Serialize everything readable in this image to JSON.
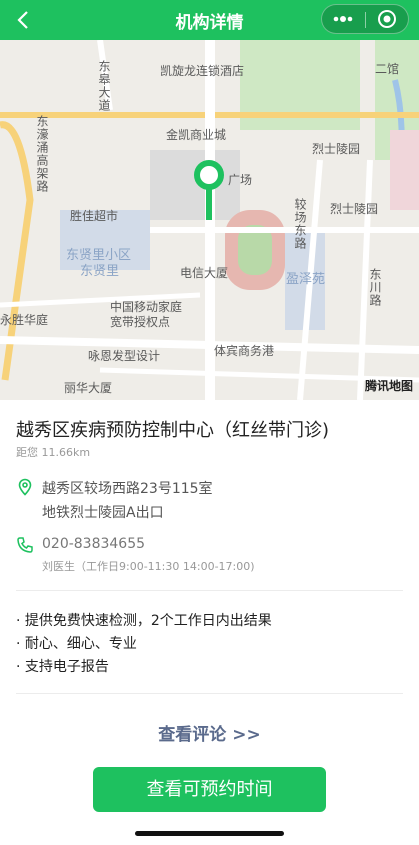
{
  "header": {
    "title": "机构详情"
  },
  "map": {
    "labels": {
      "kailong": "凯旋龙连锁酒店",
      "erguan": "二馆",
      "dongqiao": "东皋大道",
      "jinkai": "金凯商业城",
      "lieshi1": "烈士陵园",
      "donghao": "东濠涌高架路",
      "guangchang": "广场",
      "shengjia": "胜佳超市",
      "lieshi2": "烈士陵园",
      "jiaochang": "较场东路",
      "dongxian_xq": "东贤里小区",
      "dongxian": "东贤里",
      "dianxin": "电信大厦",
      "yingze": "盈泽苑",
      "dongchuan": "东川路",
      "yongsheng": "永胜华庭",
      "mobile1": "中国移动家庭",
      "mobile2": "宽带授权点",
      "tibin": "体宾商务港",
      "yongen": "咏恩发型设计",
      "lihua": "丽华大厦"
    },
    "brand": "腾讯地图"
  },
  "org": {
    "name": "越秀区疾病预防控制中心（红丝带门诊)",
    "distance": "距您 11.66km",
    "address_line1": "越秀区较场西路23号115室",
    "address_line2": "地铁烈士陵园A出口",
    "phone": "020-83834655",
    "contact": "刘医生（工作日9:00-11:30 14:00-17:00)"
  },
  "features": [
    "· 提供免费快速检测，2个工作日内出结果",
    "· 耐心、细心、专业",
    "· 支持电子报告"
  ],
  "actions": {
    "review": "查看评论 >>",
    "book": "查看可预约时间"
  },
  "colors": {
    "primary": "#1ec15f",
    "link": "#5a6a8c"
  }
}
